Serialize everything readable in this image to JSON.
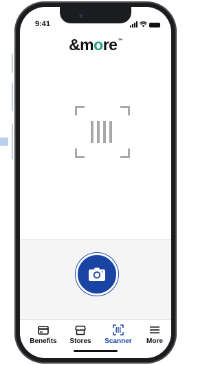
{
  "status_bar": {
    "time": "9:41",
    "icons": [
      "signal-icon",
      "wifi-icon",
      "battery-icon"
    ]
  },
  "brand": {
    "logo_prefix": "&m",
    "logo_dot": "o",
    "logo_suffix": "re",
    "trademark": "™",
    "accent_color": "#2aa083"
  },
  "scanner": {
    "viewfinder_icon": "barcode-viewfinder-icon",
    "camera_button_icon": "camera-icon",
    "primary_color": "#1a44a3"
  },
  "tab_bar": {
    "active": "Scanner",
    "items": [
      {
        "label": "Benefits",
        "icon": "card-icon"
      },
      {
        "label": "Stores",
        "icon": "store-icon"
      },
      {
        "label": "Scanner",
        "icon": "barcode-scan-icon"
      },
      {
        "label": "More",
        "icon": "menu-icon"
      }
    ]
  }
}
